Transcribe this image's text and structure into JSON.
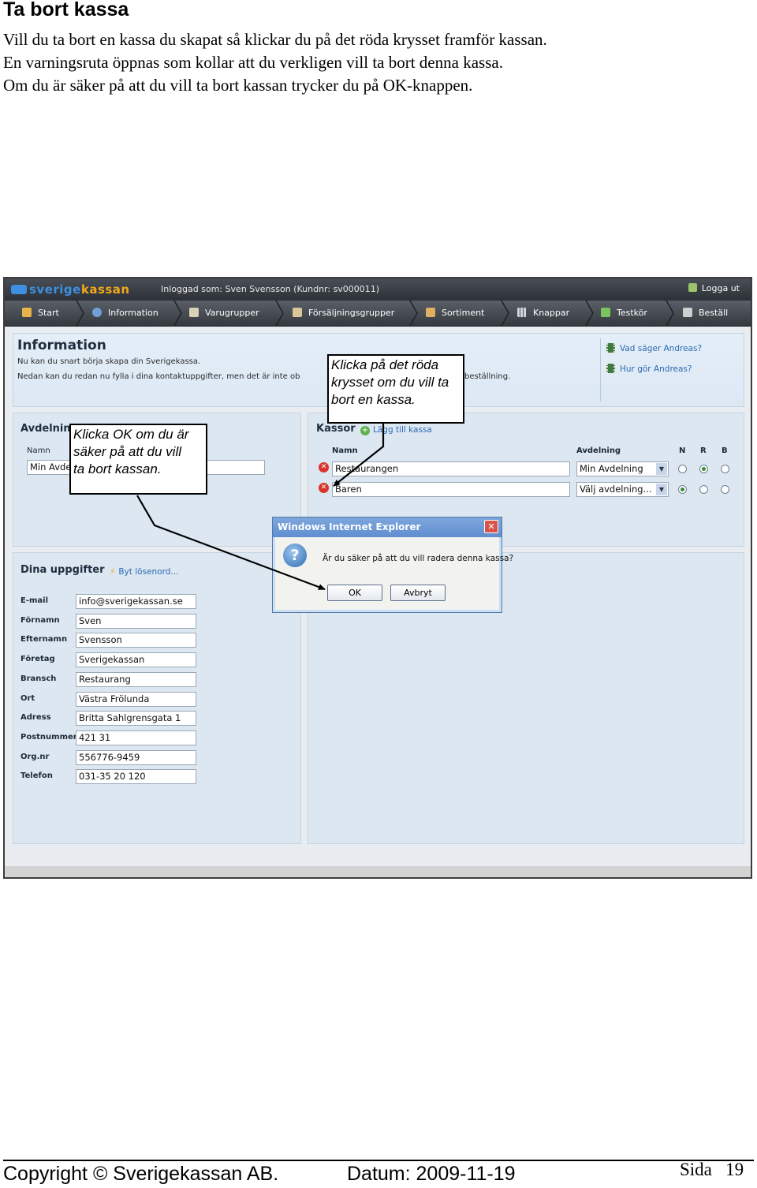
{
  "doc": {
    "heading": "Ta bort kassa",
    "paragraph": [
      "Vill du ta bort en kassa du skapat så klickar du på det röda krysset framför kassan.",
      "En varningsruta öppnas som kollar att du verkligen vill ta bort denna kassa.",
      "Om du är säker på att du vill ta bort kassan trycker du på OK-knappen."
    ]
  },
  "app": {
    "logo_part1": "sverige",
    "logo_part2": "kassan",
    "logged_in": "Inloggad som: Sven Svensson (Kundnr: sv000011)",
    "logout": "Logga ut",
    "nav": [
      "Start",
      "Information",
      "Varugrupper",
      "Försäljningsgrupper",
      "Sortiment",
      "Knappar",
      "Testkör",
      "Beställ"
    ],
    "info": {
      "title": "Information",
      "line1": "Nu kan du snart börja skapa din Sverigekassa.",
      "line2_start": "Nedan kan du redan nu fylla i dina kontaktuppgifter, men det är inte ob",
      "line2_end": "beställning.",
      "link1": "Vad säger Andreas?",
      "link2": "Hur gör Andreas?"
    },
    "avdelning": {
      "title": "Avdelnin",
      "col_name": "Namn",
      "value": "Min Avde"
    },
    "kassor": {
      "title": "Kassor",
      "add_link": "Lägg till kassa",
      "col_name": "Namn",
      "col_avd": "Avdelning",
      "col_n": "N",
      "col_r": "R",
      "col_b": "B",
      "rows": [
        {
          "name": "Restaurangen",
          "avd": "Min Avdelning"
        },
        {
          "name": "Baren",
          "avd": "Välj avdelning..."
        }
      ]
    },
    "profile": {
      "title": "Dina uppgifter",
      "change_pw": "Byt lösenord...",
      "fields": [
        {
          "label": "E-mail",
          "value": "info@sverigekassan.se"
        },
        {
          "label": "Förnamn",
          "value": "Sven"
        },
        {
          "label": "Efternamn",
          "value": "Svensson"
        },
        {
          "label": "Företag",
          "value": "Sverigekassan"
        },
        {
          "label": "Bransch",
          "value": "Restaurang"
        },
        {
          "label": "Ort",
          "value": "Västra Frölunda"
        },
        {
          "label": "Adress",
          "value": "Britta Sahlgrensgata 1"
        },
        {
          "label": "Postnummer",
          "value": "421 31"
        },
        {
          "label": "Org.nr",
          "value": "556776-9459"
        },
        {
          "label": "Telefon",
          "value": "031-35 20 120"
        }
      ]
    },
    "dialog": {
      "title": "Windows Internet Explorer",
      "message": "Är du säker på att du vill radera denna kassa?",
      "ok": "OK",
      "cancel": "Avbryt"
    }
  },
  "callouts": {
    "red_cross": [
      "Klicka på det röda",
      "krysset om du vill ta",
      "bort en kassa."
    ],
    "ok": [
      "Klicka OK om du är",
      "säker på att du vill",
      "ta bort kassan."
    ]
  },
  "footer": {
    "copyright": "Copyright ©  Sverigekassan AB.",
    "date": "Datum:  2009-11-19",
    "page_label": "Sida",
    "page_number": "19"
  }
}
